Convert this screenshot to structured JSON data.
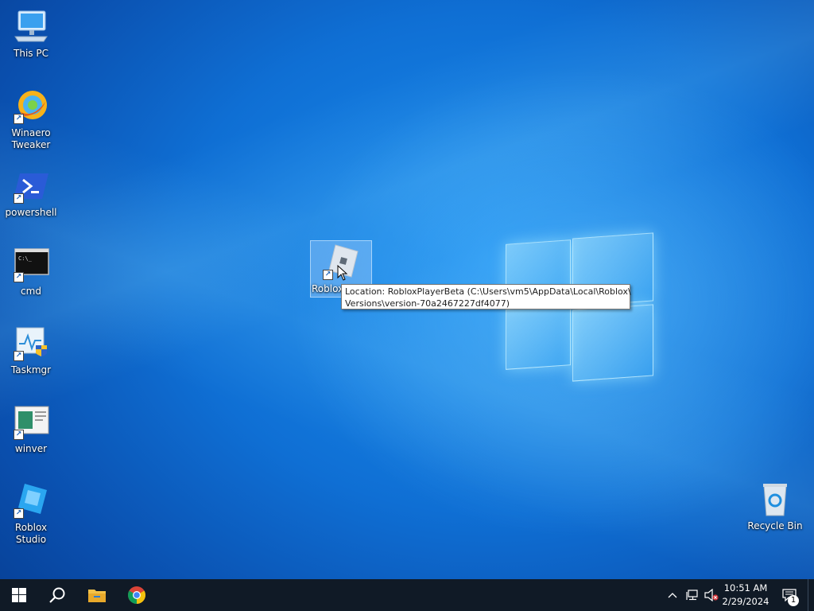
{
  "desktop": {
    "icons": [
      {
        "label": "This PC"
      },
      {
        "label": "Winaero\nTweaker"
      },
      {
        "label": "powershell"
      },
      {
        "label": "cmd"
      },
      {
        "label": "Taskmgr"
      },
      {
        "label": "winver"
      },
      {
        "label": "Roblox Studio"
      },
      {
        "label": "Roblox"
      },
      {
        "label": "Recycle Bin"
      }
    ],
    "tooltip": {
      "line1": "Location: RobloxPlayerBeta (C:\\Users\\vm5\\AppData\\Local\\Roblox\\",
      "line2": "Versions\\version-70a2467227df4077)"
    }
  },
  "taskbar": {
    "items": [
      "start-icon",
      "search-icon",
      "file-explorer-icon",
      "chrome-icon"
    ],
    "tray": {
      "time": "10:51 AM",
      "date": "2/29/2024",
      "notification_count": "1"
    }
  },
  "colors": {
    "taskbar": "#101a26",
    "desktop_accent": "#0f6fd4",
    "tooltip_bg": "#ffffff"
  }
}
